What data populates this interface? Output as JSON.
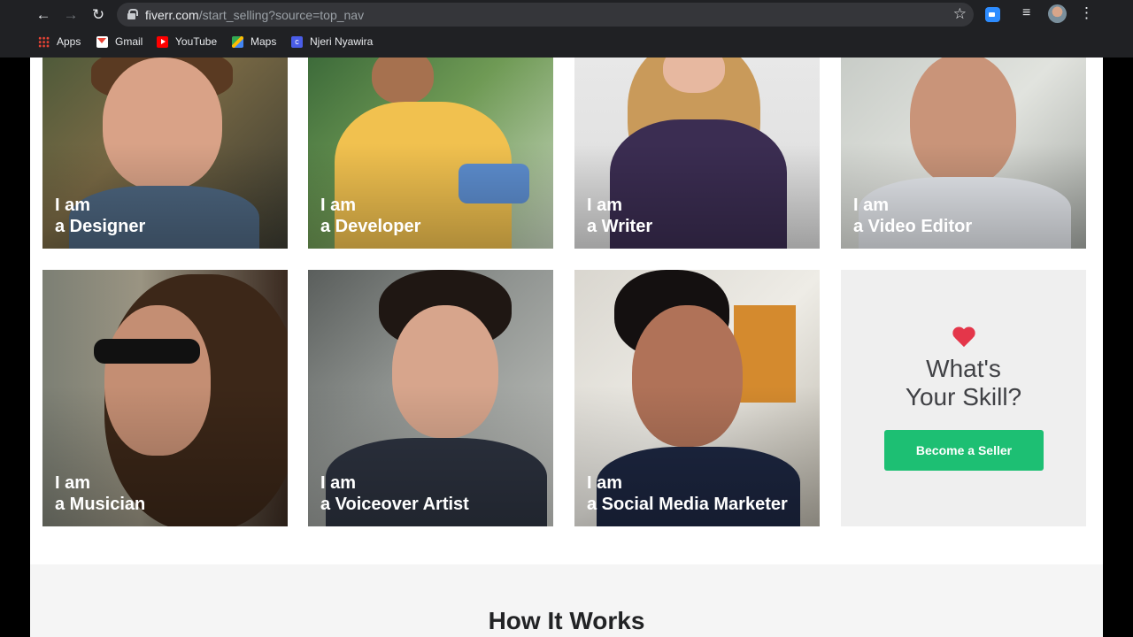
{
  "browser": {
    "url_host": "fiverr.com",
    "url_path": "/start_selling?source=top_nav",
    "bookmarks": [
      {
        "label": "Apps",
        "icon": "apps-grid-icon"
      },
      {
        "label": "Gmail",
        "icon": "gmail-icon"
      },
      {
        "label": "YouTube",
        "icon": "youtube-icon"
      },
      {
        "label": "Maps",
        "icon": "maps-icon"
      },
      {
        "label": "Njeri Nyawira",
        "icon": "canva-icon"
      }
    ]
  },
  "profiles": [
    {
      "line1": "I am",
      "line2": "a Designer"
    },
    {
      "line1": "I am",
      "line2": "a Developer"
    },
    {
      "line1": "I am",
      "line2": "a Writer"
    },
    {
      "line1": "I am",
      "line2": "a Video Editor"
    },
    {
      "line1": "I am",
      "line2": "a Musician"
    },
    {
      "line1": "I am",
      "line2": "a Voiceover Artist"
    },
    {
      "line1": "I am",
      "line2": "a Social Media Marketer"
    }
  ],
  "skill_card": {
    "title_line1": "What's",
    "title_line2": "Your Skill?",
    "button_label": "Become a Seller",
    "button_color": "#1dbf73",
    "heart_color": "#e4364a"
  },
  "how_it_works": {
    "title": "How It Works"
  }
}
